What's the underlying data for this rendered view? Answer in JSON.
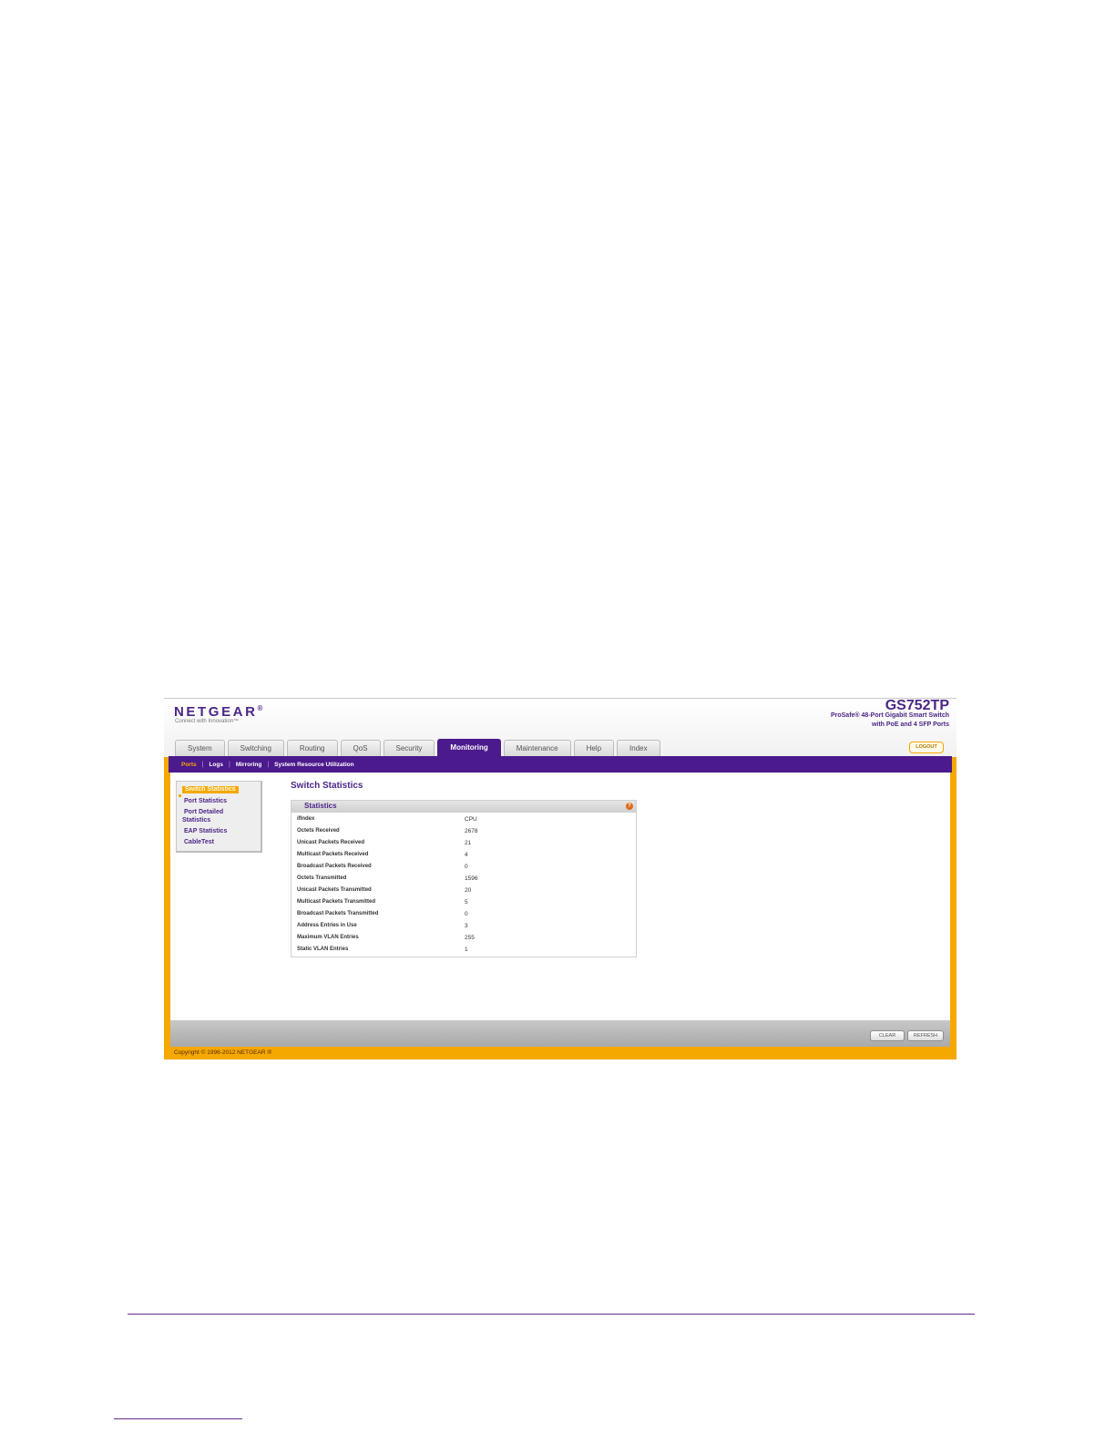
{
  "brand": {
    "logo": "NETGEAR",
    "tagline": "Connect with Innovation™"
  },
  "product": {
    "model": "GS752TP",
    "desc_line1": "ProSafe® 48-Port Gigabit Smart Switch",
    "desc_line2": "with PoE and 4 SFP Ports"
  },
  "tabs": [
    {
      "label": "System"
    },
    {
      "label": "Switching"
    },
    {
      "label": "Routing"
    },
    {
      "label": "QoS"
    },
    {
      "label": "Security"
    },
    {
      "label": "Monitoring",
      "active": true
    },
    {
      "label": "Maintenance"
    },
    {
      "label": "Help"
    },
    {
      "label": "Index"
    }
  ],
  "logout_label": "LOGOUT",
  "subnav": [
    {
      "label": "Ports",
      "active": true
    },
    {
      "label": "Logs"
    },
    {
      "label": "Mirroring"
    },
    {
      "label": "System Resource Utilization"
    }
  ],
  "sidemenu": [
    {
      "label": "Switch Statistics",
      "selected": true
    },
    {
      "label": "Port Statistics"
    },
    {
      "label": "Port Detailed"
    },
    {
      "label": "Statistics"
    },
    {
      "label": "EAP Statistics"
    },
    {
      "label": "CableTest"
    }
  ],
  "page_title": "Switch Statistics",
  "stats": {
    "title": "Statistics",
    "help": "?",
    "rows": [
      {
        "k": "ifIndex",
        "v": "CPU"
      },
      {
        "k": "Octets Received",
        "v": "2678"
      },
      {
        "k": "Unicast Packets Received",
        "v": "21"
      },
      {
        "k": "Multicast Packets Received",
        "v": "4"
      },
      {
        "k": "Broadcast Packets Received",
        "v": "0"
      },
      {
        "k": "Octets Transmitted",
        "v": "1596"
      },
      {
        "k": "Unicast Packets Transmitted",
        "v": "20"
      },
      {
        "k": "Multicast Packets Transmitted",
        "v": "5"
      },
      {
        "k": "Broadcast Packets Transmitted",
        "v": "0"
      },
      {
        "k": "Address Entries in Use",
        "v": "3"
      },
      {
        "k": "Maximum VLAN Entries",
        "v": "255"
      },
      {
        "k": "Static VLAN Entries",
        "v": "1"
      }
    ]
  },
  "buttons": {
    "clear": "CLEAR",
    "refresh": "REFRESH"
  },
  "copyright": "Copyright © 1996-2012 NETGEAR ®",
  "colors": {
    "brand_purple": "#4b1a8c",
    "frame_orange": "#f5a800"
  }
}
